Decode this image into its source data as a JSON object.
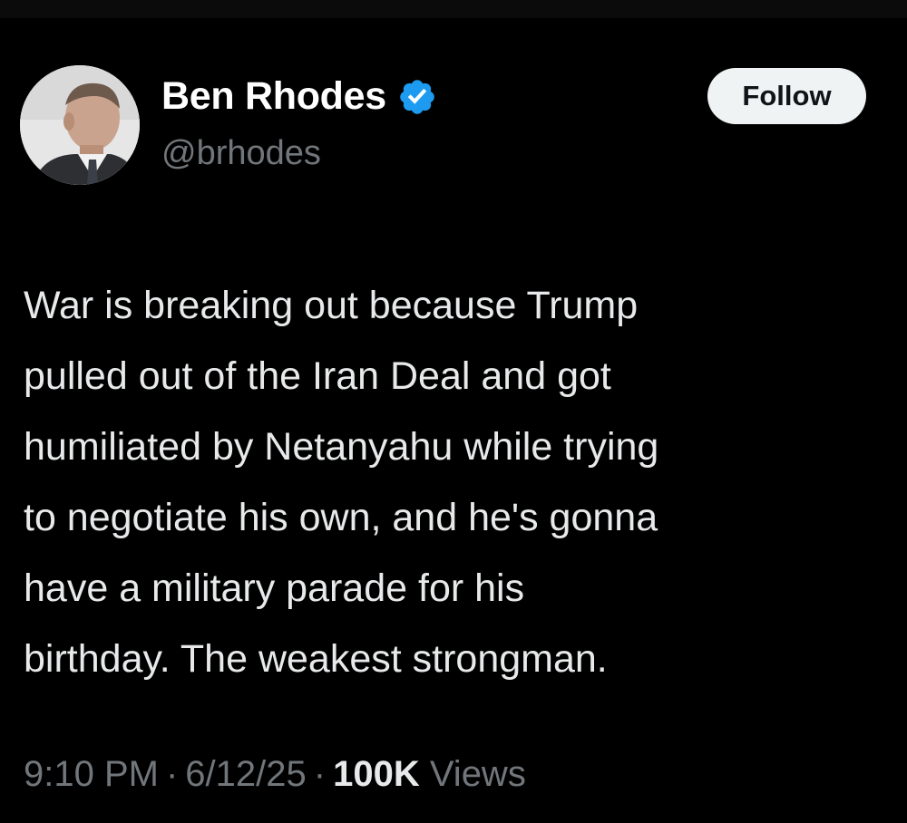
{
  "author": {
    "display_name": "Ben Rhodes",
    "handle": "@brhodes",
    "verified_icon": "verified-badge-icon",
    "verified_color": "#1d9bf0"
  },
  "actions": {
    "follow_label": "Follow"
  },
  "tweet": {
    "lines": [
      "War is breaking out because Trump",
      "pulled out of the Iran Deal and got",
      "humiliated by Netanyahu while trying",
      "to negotiate his own, and he's gonna",
      "have a military parade for his",
      "birthday. The weakest strongman."
    ]
  },
  "meta": {
    "time": "9:10 PM",
    "separator": "·",
    "date": "6/12/25",
    "views_count": "100K",
    "views_label": "Views"
  },
  "colors": {
    "background": "#000000",
    "text_primary": "#e7e9ea",
    "text_secondary": "#71767b",
    "button_bg": "#eff3f4"
  }
}
